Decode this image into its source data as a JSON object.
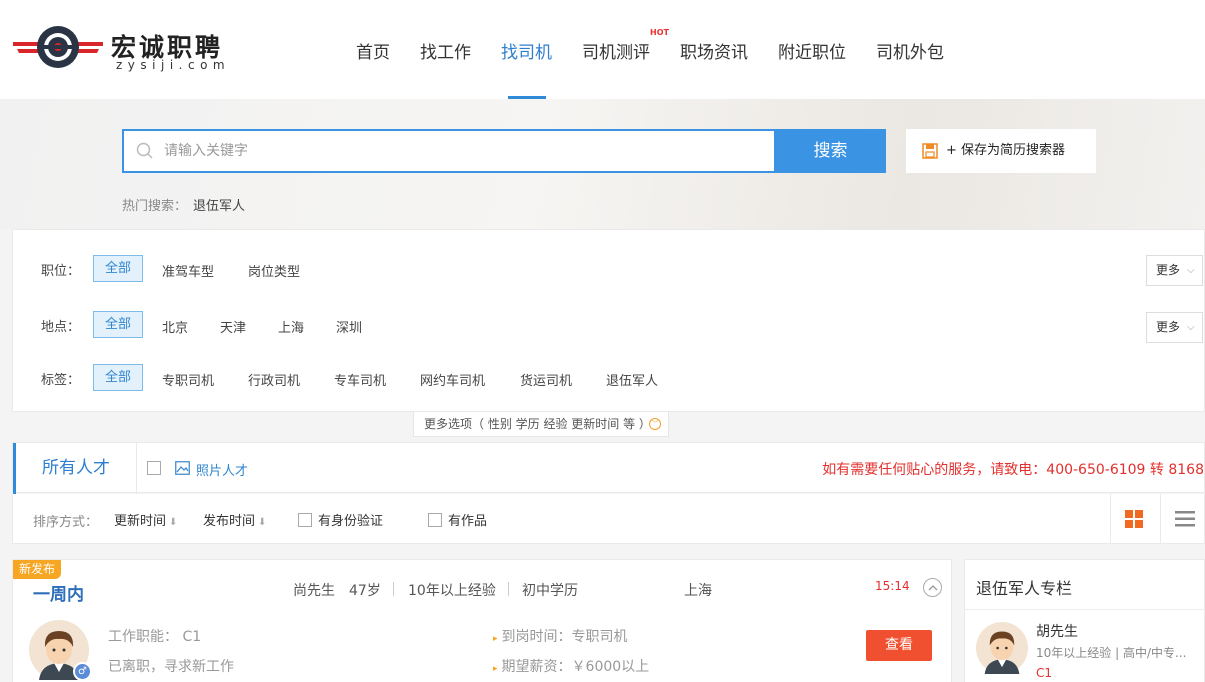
{
  "brand": {
    "name": "宏诚职聘",
    "domain": "zysiji.com"
  },
  "nav": {
    "items": [
      "首页",
      "找工作",
      "找司机",
      "司机测评",
      "职场资讯",
      "附近职位",
      "司机外包"
    ],
    "active": "找司机",
    "hot_badge": "HOT"
  },
  "search": {
    "placeholder": "请输入关键字",
    "button": "搜索",
    "save_label": "+ 保存为简历搜索器",
    "hot_label": "热门搜索：",
    "hot_keyword": "退伍军人"
  },
  "filters": {
    "position": {
      "label": "职位：",
      "options": [
        "全部",
        "准驾车型",
        "岗位类型"
      ]
    },
    "location": {
      "label": "地点：",
      "options": [
        "全部",
        "北京",
        "天津",
        "上海",
        "深圳"
      ]
    },
    "tags": {
      "label": "标签：",
      "options": [
        "全部",
        "专职司机",
        "行政司机",
        "专车司机",
        "网约车司机",
        "货运司机",
        "退伍军人"
      ]
    },
    "more_label": "更多",
    "more_options": "更多选项（ 性别 学历 经验 更新时间 等 ）"
  },
  "tabs": {
    "all": "所有人才",
    "photo": "照片人才",
    "hotline": "如有需要任何贴心的服务，请致电：400-650-6109 转 8168"
  },
  "sort": {
    "label": "排序方式：",
    "update_time": "更新时间",
    "publish_time": "发布时间",
    "id_verified": "有身份验证",
    "has_works": "有作品"
  },
  "card": {
    "badge": "新发布",
    "period": "一周内",
    "name": "尚先生",
    "age": "47岁",
    "experience": "10年以上经验",
    "education": "初中学历",
    "city": "上海",
    "time": "15:14",
    "job_function": "工作职能： C1",
    "status": "已离职，寻求新工作",
    "arrival": "到岗时间：专职司机",
    "salary": "期望薪资：￥6000以上",
    "view_button": "查看",
    "gender": "♂"
  },
  "sidebar": {
    "title": "退伍军人专栏",
    "name": "胡先生",
    "meta": "10年以上经验 | 高中/中专...",
    "tag": "C1"
  },
  "colors": {
    "accent": "#3b94e3",
    "hot": "#e3302e",
    "badge": "#f6a623",
    "view": "#f0502f"
  }
}
